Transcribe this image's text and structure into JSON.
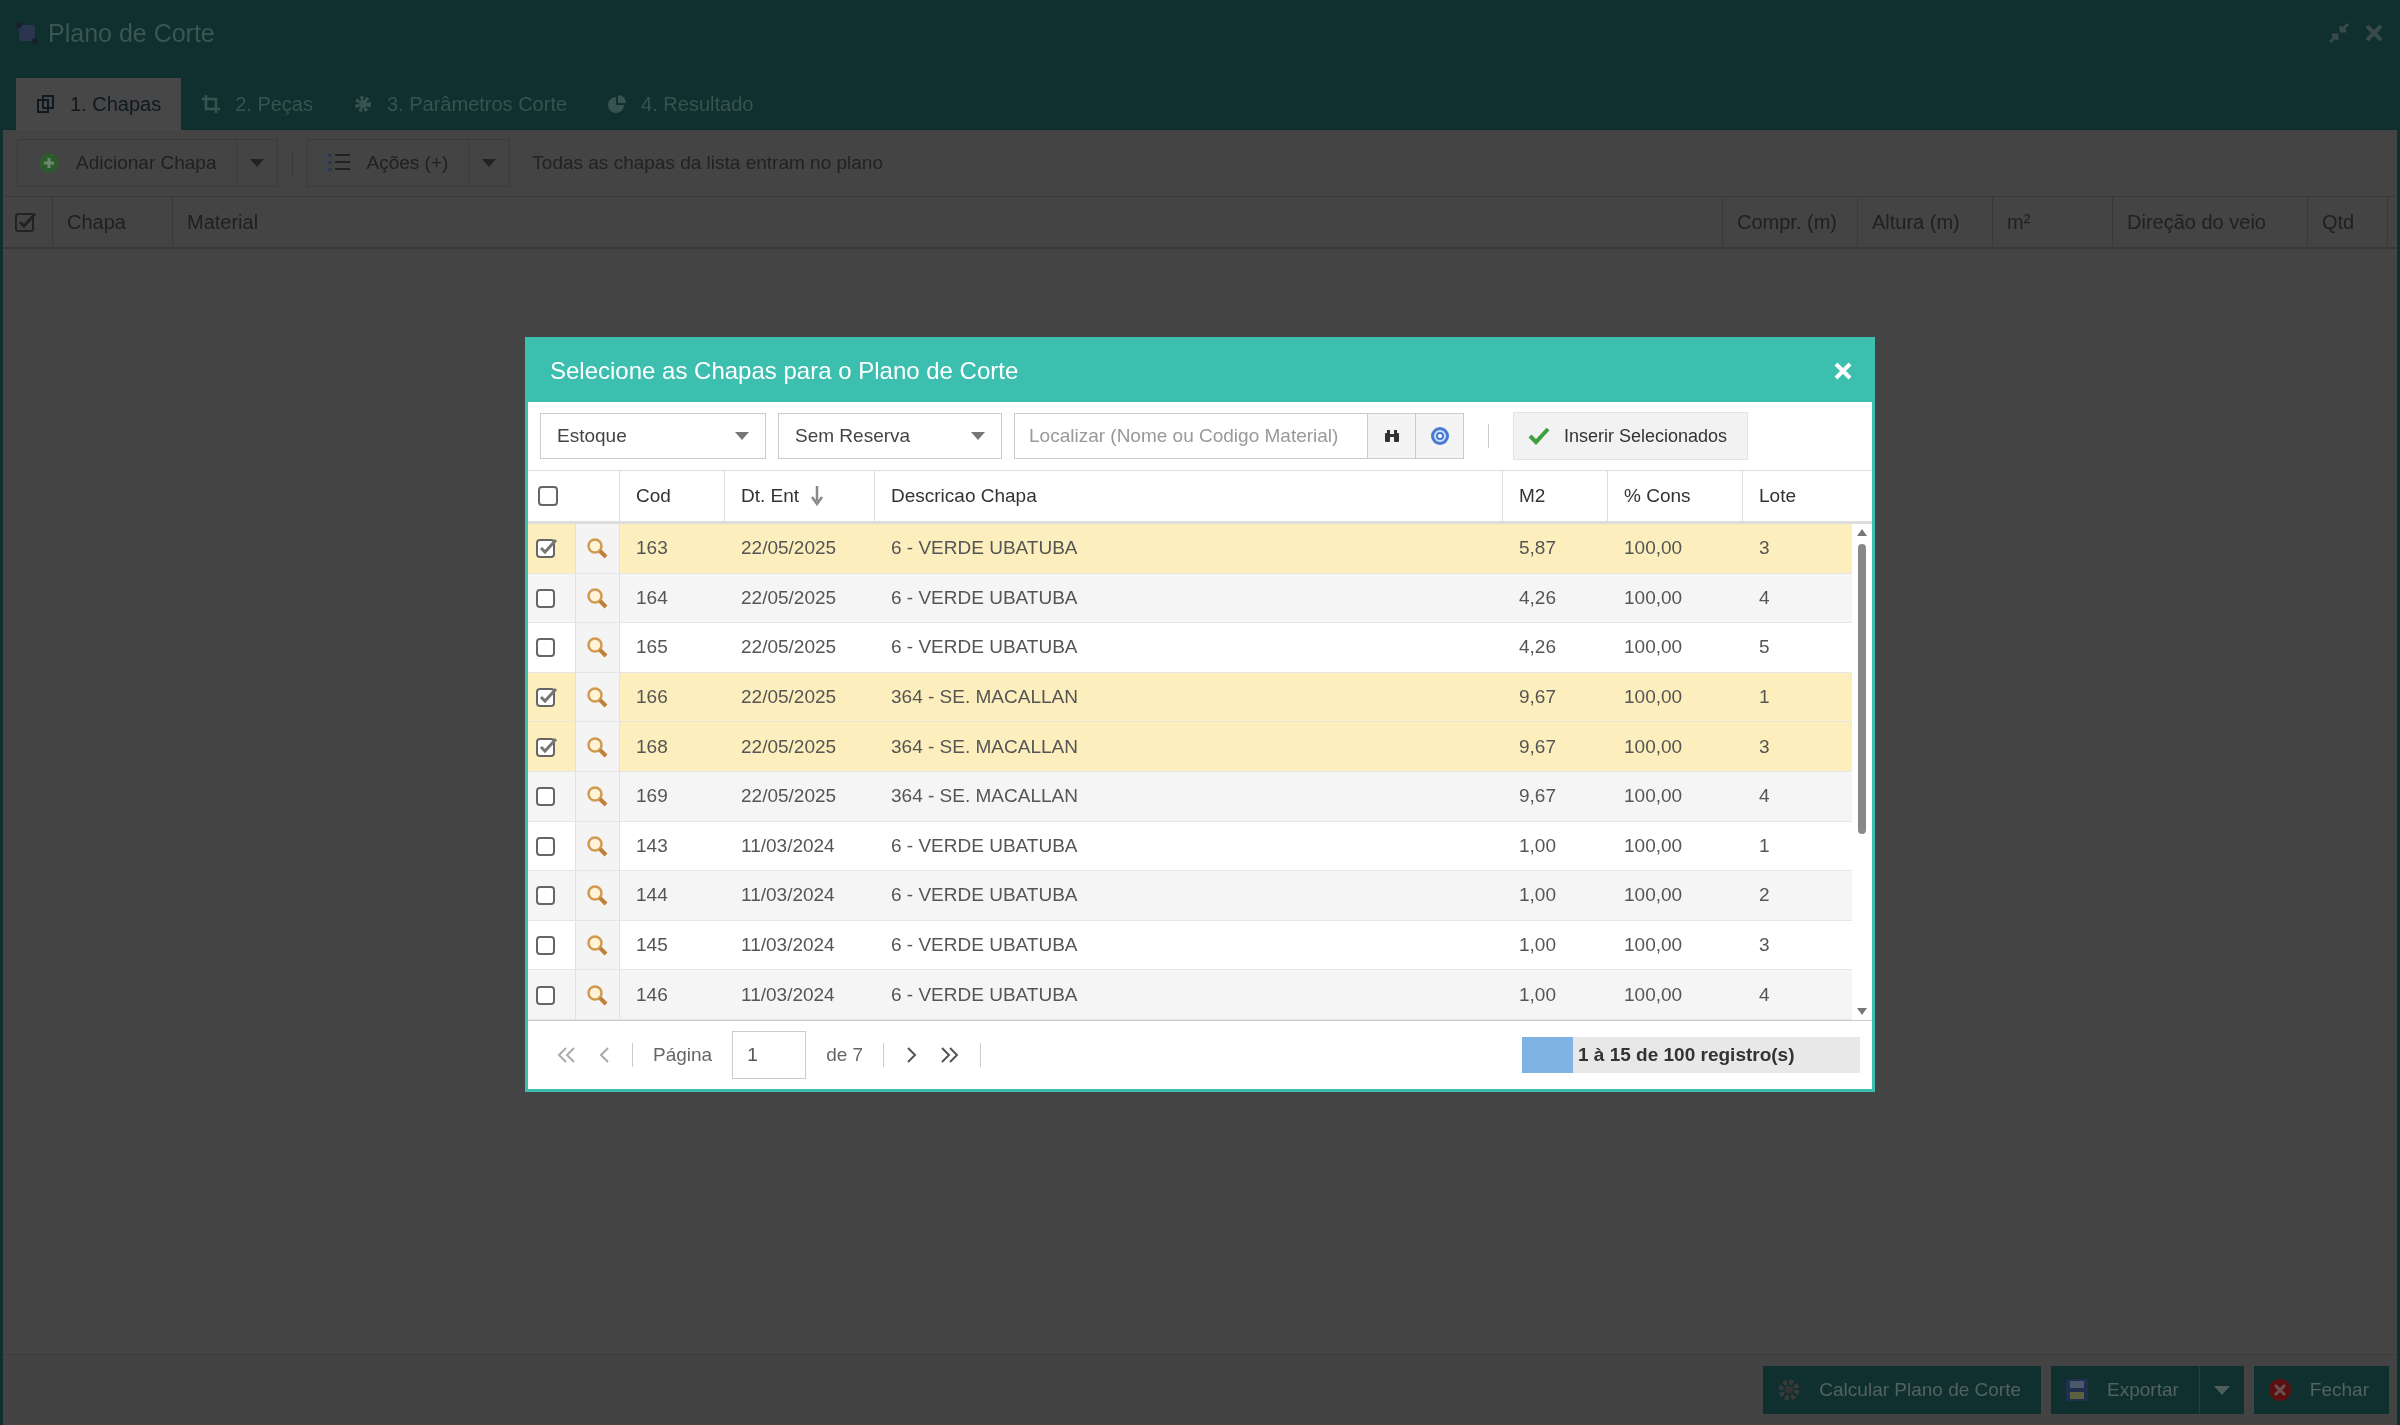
{
  "window": {
    "title": "Plano de Corte"
  },
  "tabs": [
    {
      "label": "1. Chapas",
      "selected": true
    },
    {
      "label": "2. Peças",
      "selected": false
    },
    {
      "label": "3. Parâmetros Corte",
      "selected": false
    },
    {
      "label": "4. Resultado",
      "selected": false
    }
  ],
  "toolbar": {
    "add_button": "Adicionar Chapa",
    "actions_button": "Ações (+)",
    "hint": "Todas as chapas da lista entram no plano"
  },
  "grid": {
    "header_checked": true,
    "columns": [
      "Chapa",
      "Material",
      "Compr. (m)",
      "Altura (m)",
      "m²",
      "Direção do veio",
      "Qtd"
    ]
  },
  "footer_buttons": [
    {
      "label": "Calcular Plano de Corte",
      "kind": "calculate"
    },
    {
      "label": "Exportar",
      "kind": "export"
    },
    {
      "label": "Fechar",
      "kind": "close"
    }
  ],
  "dialog": {
    "title": "Selecione as Chapas para o Plano de Corte",
    "filters": [
      {
        "value": "Estoque"
      },
      {
        "value": "Sem Reserva"
      }
    ],
    "search": {
      "placeholder": "Localizar (Nome ou Codigo Material)"
    },
    "insert_button": "Inserir Selecionados",
    "select_all": {
      "checked": false
    },
    "columns": [
      {
        "label": "Cod",
        "sorted": false
      },
      {
        "label": "Dt. Ent",
        "sorted": true
      },
      {
        "label": "Descricao Chapa",
        "sorted": false
      },
      {
        "label": "M2",
        "sorted": false
      },
      {
        "label": "% Cons",
        "sorted": false
      },
      {
        "label": "Lote",
        "sorted": false
      }
    ],
    "rows": [
      {
        "checked": true,
        "cod": "163",
        "date": "22/05/2025",
        "description": "6 - VERDE UBATUBA",
        "m2": "5,87",
        "cons": "100,00",
        "lote": "3"
      },
      {
        "checked": false,
        "cod": "164",
        "date": "22/05/2025",
        "description": "6 - VERDE UBATUBA",
        "m2": "4,26",
        "cons": "100,00",
        "lote": "4"
      },
      {
        "checked": false,
        "cod": "165",
        "date": "22/05/2025",
        "description": "6 - VERDE UBATUBA",
        "m2": "4,26",
        "cons": "100,00",
        "lote": "5"
      },
      {
        "checked": true,
        "cod": "166",
        "date": "22/05/2025",
        "description": "364 - SE. MACALLAN",
        "m2": "9,67",
        "cons": "100,00",
        "lote": "1"
      },
      {
        "checked": true,
        "cod": "168",
        "date": "22/05/2025",
        "description": "364 - SE. MACALLAN",
        "m2": "9,67",
        "cons": "100,00",
        "lote": "3"
      },
      {
        "checked": false,
        "cod": "169",
        "date": "22/05/2025",
        "description": "364 - SE. MACALLAN",
        "m2": "9,67",
        "cons": "100,00",
        "lote": "4"
      },
      {
        "checked": false,
        "cod": "143",
        "date": "11/03/2024",
        "description": "6 - VERDE UBATUBA",
        "m2": "1,00",
        "cons": "100,00",
        "lote": "1"
      },
      {
        "checked": false,
        "cod": "144",
        "date": "11/03/2024",
        "description": "6 - VERDE UBATUBA",
        "m2": "1,00",
        "cons": "100,00",
        "lote": "2"
      },
      {
        "checked": false,
        "cod": "145",
        "date": "11/03/2024",
        "description": "6 - VERDE UBATUBA",
        "m2": "1,00",
        "cons": "100,00",
        "lote": "3"
      },
      {
        "checked": false,
        "cod": "146",
        "date": "11/03/2024",
        "description": "6 - VERDE UBATUBA",
        "m2": "1,00",
        "cons": "100,00",
        "lote": "4"
      }
    ],
    "pager": {
      "page_label": "Página",
      "page": "1",
      "of_label": "de 7",
      "summary": "1 à 15 de 100 registro(s)",
      "level": 0.15
    }
  }
}
